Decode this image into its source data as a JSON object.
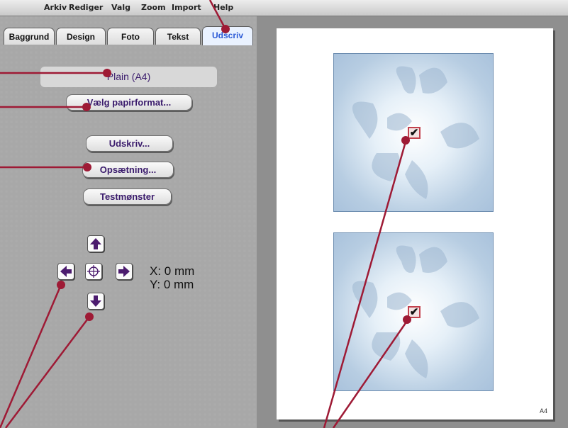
{
  "menu": [
    "Arkiv",
    "Rediger",
    "Valg",
    "Zoom",
    "Import",
    "Help"
  ],
  "tabs": [
    "Baggrund",
    "Design",
    "Foto",
    "Tekst",
    "Udscriv"
  ],
  "active_tab": "Udscriv",
  "paper": {
    "format_label": "Plain (A4)",
    "choose_button": "Vælg papirformat..."
  },
  "buttons": {
    "print": "Udskriv...",
    "setup": "Opsætning...",
    "test": "Testmønster"
  },
  "position": {
    "x": "X: 0 mm",
    "y": "Y: 0 mm"
  },
  "preview": {
    "page_label": "A4"
  },
  "colors": {
    "accent": "#9e1a35",
    "button_text": "#3a1b6c",
    "arrow": "#4b1b6e",
    "active_tab": "#2d5bd6"
  },
  "icons": [
    "arrow-up-icon",
    "arrow-left-icon",
    "crosshair-icon",
    "arrow-right-icon",
    "arrow-down-icon",
    "checkmark-icon",
    "butterfly-icon"
  ]
}
